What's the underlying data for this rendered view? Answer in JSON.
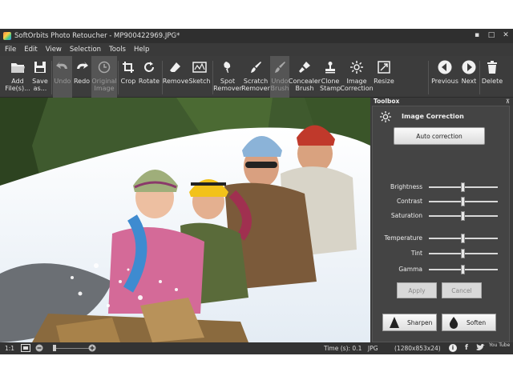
{
  "window": {
    "title": "SoftOrbits Photo Retoucher - MP900422969.JPG*"
  },
  "window_controls": {
    "minimize": "▪",
    "restore": "□",
    "close": "✕"
  },
  "menu": [
    "File",
    "Edit",
    "View",
    "Selection",
    "Tools",
    "Help"
  ],
  "toolbar": {
    "add": "Add\nFile(s)...",
    "save": "Save\nas...",
    "undo": "Undo",
    "redo": "Redo",
    "original": "Original\nImage",
    "crop": "Crop",
    "rotate": "Rotate",
    "remove": "Remove",
    "sketch": "Sketch",
    "spot": "Spot\nRemover",
    "scratch": "Scratch\nRemover",
    "undo_brush": "Undo\nBrush",
    "concealer": "Concealer\nBrush",
    "clone": "Clone\nStamp",
    "image_correction": "Image\nCorrection",
    "resize": "Resize",
    "previous": "Previous",
    "next": "Next",
    "delete": "Delete"
  },
  "toolbox": {
    "header": "Toolbox",
    "pin": "⊼",
    "section_title": "Image Correction",
    "auto_correction": "Auto correction",
    "sliders": [
      {
        "label": "Brightness",
        "value": 0.5
      },
      {
        "label": "Contrast",
        "value": 0.5
      },
      {
        "label": "Saturation",
        "value": 0.5
      },
      {
        "label": "Temperature",
        "value": 0.5
      },
      {
        "label": "Tint",
        "value": 0.5
      },
      {
        "label": "Gamma",
        "value": 0.5
      }
    ],
    "apply": "Apply",
    "cancel": "Cancel",
    "sharpen": "Sharpen",
    "soften": "Soften"
  },
  "status": {
    "zoom": "1:1",
    "time": "Time (s): 0.1",
    "format": "JPG",
    "dimensions": "(1280x853x24)",
    "info": "i",
    "facebook": "f",
    "twitter": "t",
    "youtube": "You Tube"
  }
}
